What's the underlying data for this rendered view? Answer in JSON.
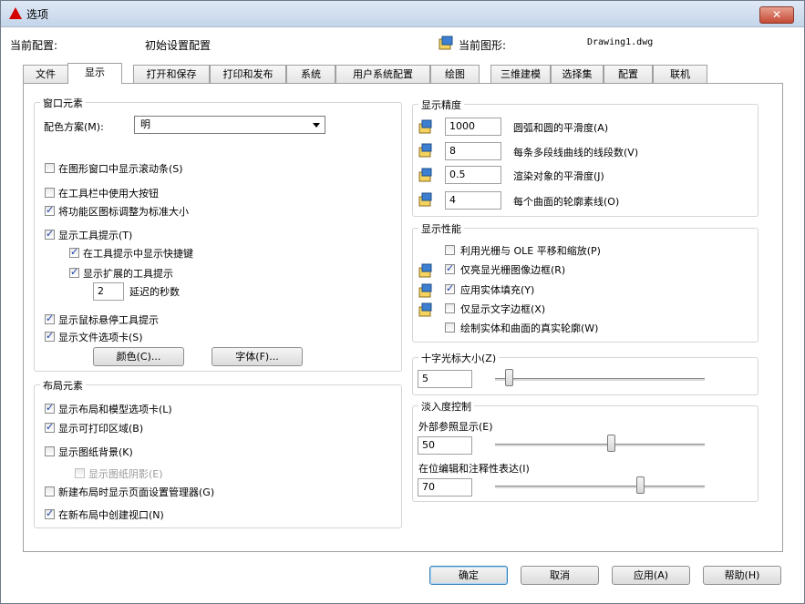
{
  "window": {
    "title": "选项",
    "close_label": "✕"
  },
  "info": {
    "current_profile_label": "当前配置:",
    "current_profile_value": "初始设置配置",
    "current_drawing_label": "当前图形:",
    "current_drawing_value": "Drawing1.dwg"
  },
  "tabs": [
    {
      "label": "文件"
    },
    {
      "label": "显示"
    },
    {
      "label": "打开和保存"
    },
    {
      "label": "打印和发布"
    },
    {
      "label": "系统"
    },
    {
      "label": "用户系统配置"
    },
    {
      "label": "绘图"
    },
    {
      "label": "三维建模"
    },
    {
      "label": "选择集"
    },
    {
      "label": "配置"
    },
    {
      "label": "联机"
    }
  ],
  "window_elements": {
    "title": "窗口元素",
    "color_scheme_label": "配色方案(M):",
    "color_scheme_value": "明",
    "cb_scrollbars": "在图形窗口中显示滚动条(S)",
    "cb_large_buttons": "在工具栏中使用大按钮",
    "cb_resize_ribbon_icons": "将功能区图标调整为标准大小",
    "cb_show_tooltips": "显示工具提示(T)",
    "cb_shortcut_in_tooltips": "在工具提示中显示快捷键",
    "cb_extended_tooltips": "显示扩展的工具提示",
    "delay_value": "2",
    "delay_label": "延迟的秒数",
    "cb_rollover_tooltips": "显示鼠标悬停工具提示",
    "cb_file_tabs": "显示文件选项卡(S)",
    "colors_button": "颜色(C)...",
    "fonts_button": "字体(F)..."
  },
  "layout_elements": {
    "title": "布局元素",
    "cb_layout_model_tabs": "显示布局和模型选项卡(L)",
    "cb_printable_area": "显示可打印区域(B)",
    "cb_paper_background": "显示图纸背景(K)",
    "cb_paper_shadow": "显示图纸阴影(E)",
    "cb_page_setup_manager": "新建布局时显示页面设置管理器(G)",
    "cb_create_viewport": "在新布局中创建视口(N)"
  },
  "display_resolution": {
    "title": "显示精度",
    "arc_smoothness_value": "1000",
    "arc_smoothness_label": "圆弧和圆的平滑度(A)",
    "polyline_segments_value": "8",
    "polyline_segments_label": "每条多段线曲线的线段数(V)",
    "rendered_smoothness_value": "0.5",
    "rendered_smoothness_label": "渲染对象的平滑度(J)",
    "contour_lines_value": "4",
    "contour_lines_label": "每个曲面的轮廓素线(O)"
  },
  "display_performance": {
    "title": "显示性能",
    "cb_pan_zoom_raster": "利用光栅与 OLE 平移和缩放(P)",
    "cb_raster_frame": "仅亮显光栅图像边框(R)",
    "cb_solid_fill": "应用实体填充(Y)",
    "cb_text_frame": "仅显示文字边框(X)",
    "cb_silhouettes": "绘制实体和曲面的真实轮廓(W)"
  },
  "crosshair": {
    "title": "十字光标大小(Z)",
    "value": "5",
    "level": 5
  },
  "fade_control": {
    "title": "淡入度控制",
    "xref_label": "外部参照显示(E)",
    "xref_value": "50",
    "xref_level": 50,
    "inplace_label": "在位编辑和注释性表达(I)",
    "inplace_value": "70",
    "inplace_level": 70
  },
  "footer": {
    "ok": "确定",
    "cancel": "取消",
    "apply": "应用(A)",
    "help": "帮助(H)"
  },
  "colors": {
    "accent_red": "#d40000",
    "title_bg": "#c4d5ea",
    "checkmark": "#1a3fa8"
  }
}
